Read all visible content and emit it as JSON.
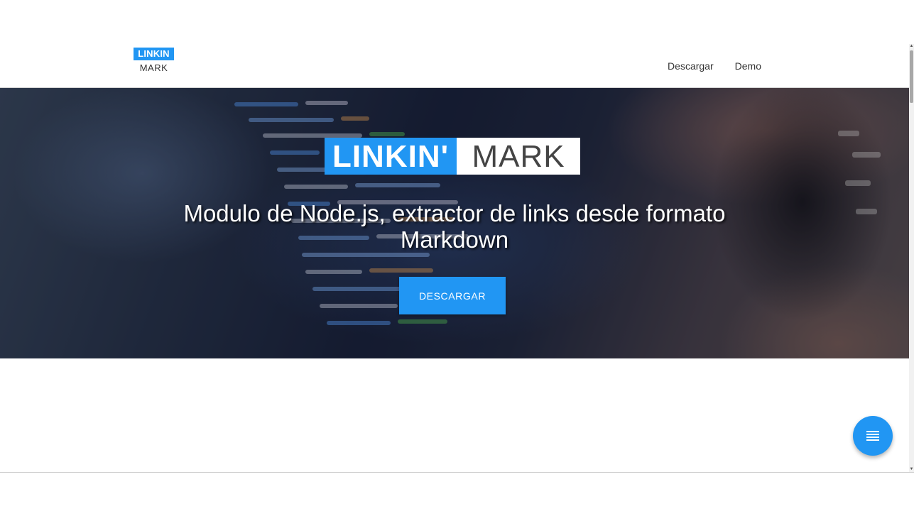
{
  "navbar": {
    "logo_top": "LINKIN",
    "logo_bottom": "MARK",
    "links": [
      {
        "label": "Descargar"
      },
      {
        "label": "Demo"
      }
    ]
  },
  "hero": {
    "logo_left": "LINKIN'",
    "logo_right": "MARK",
    "title": "Modulo de Node.js, extractor de links desde formato Markdown",
    "button_label": "DESCARGAR"
  },
  "fab": {
    "icon": "menu-lines-icon"
  },
  "colors": {
    "accent": "#2196f3",
    "nav_text": "#333333"
  }
}
